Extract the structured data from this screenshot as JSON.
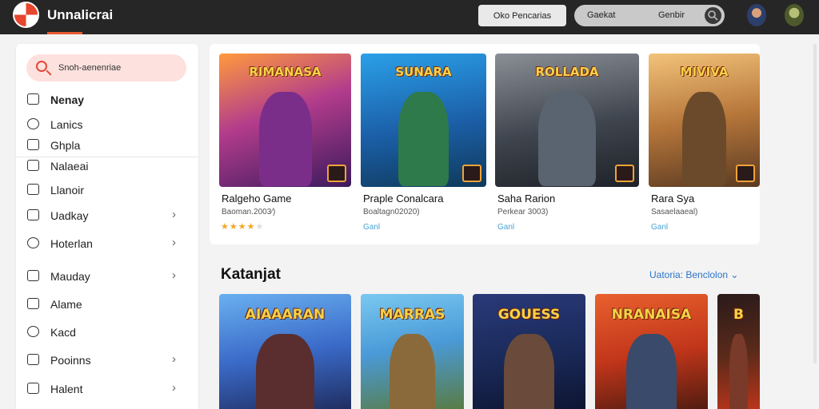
{
  "app": {
    "title": "Unnalicrai"
  },
  "topbar": {
    "button_label": "Oko Pencarias",
    "search_left": "Gaekat",
    "search_right": "Genbir"
  },
  "sidebar": {
    "search_placeholder": "Snoh-aenenriae",
    "items": [
      {
        "label": "Nenay",
        "icon": "home-icon",
        "chevron": false
      },
      {
        "label": "Lanics",
        "icon": "chat-icon",
        "chevron": false
      },
      {
        "label": "Ghpla",
        "icon": "gamepad-icon",
        "chevron": false
      },
      {
        "label": "Nalaeai",
        "icon": "folder-icon",
        "chevron": false
      },
      {
        "label": "Llanoir",
        "icon": "tag-icon",
        "chevron": false
      },
      {
        "label": "Uadkay",
        "icon": "calendar-icon",
        "chevron": true
      },
      {
        "label": "Hoterlan",
        "icon": "target-icon",
        "chevron": true
      },
      {
        "label": "Mauday",
        "icon": "pen-icon",
        "chevron": true
      },
      {
        "label": "Alame",
        "icon": "box-icon",
        "chevron": false
      },
      {
        "label": "Kacd",
        "icon": "clock-icon",
        "chevron": false
      },
      {
        "label": "Pooinns",
        "icon": "card-icon",
        "chevron": true
      },
      {
        "label": "Halent",
        "icon": "bag-icon",
        "chevron": true
      }
    ]
  },
  "featured": [
    {
      "cover_title": "RIMANASA",
      "name": "Ralgeho Game",
      "sub": "Baoman.2003⁄)",
      "link": "",
      "rating": 4
    },
    {
      "cover_title": "SUNARA",
      "name": "Praple Conalcara",
      "sub": "Boaltagn02020)",
      "link": "Ganl",
      "rating": 0
    },
    {
      "cover_title": "ROLLADA",
      "name": "Saha Rarion",
      "sub": "Perkear 3003)",
      "link": "Ganl",
      "rating": 0
    },
    {
      "cover_title": "MIVIVA",
      "name": "Rara Sya",
      "sub": "Sasaelaaeal)",
      "link": "Ganl",
      "rating": 0
    }
  ],
  "section": {
    "title": "Katanjat",
    "link": "Uatoria: Benclolon"
  },
  "row2": [
    {
      "cover_title": "AIAAARAN"
    },
    {
      "cover_title": "MARRAS"
    },
    {
      "cover_title": "GOUESS"
    },
    {
      "cover_title": "NRANAISA"
    },
    {
      "cover_title": "B"
    }
  ],
  "colors": {
    "accent": "#e8592e",
    "link": "#2e74c8",
    "topbar": "#262626"
  }
}
